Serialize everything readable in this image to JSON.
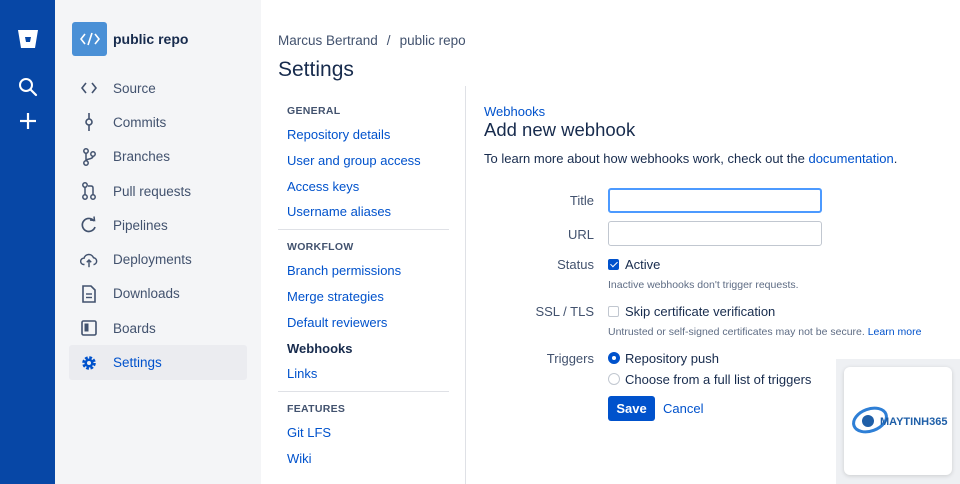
{
  "repo": {
    "name": "public repo"
  },
  "project_nav": [
    {
      "label": "Source",
      "icon": "code-icon"
    },
    {
      "label": "Commits",
      "icon": "commit-icon"
    },
    {
      "label": "Branches",
      "icon": "branch-icon"
    },
    {
      "label": "Pull requests",
      "icon": "pull-request-icon"
    },
    {
      "label": "Pipelines",
      "icon": "pipelines-icon"
    },
    {
      "label": "Deployments",
      "icon": "cloud-upload-icon"
    },
    {
      "label": "Downloads",
      "icon": "document-icon"
    },
    {
      "label": "Boards",
      "icon": "board-icon"
    },
    {
      "label": "Settings",
      "icon": "gear-icon",
      "active": true
    }
  ],
  "breadcrumb": {
    "owner": "Marcus Bertrand",
    "separator": "/",
    "repo": "public repo"
  },
  "page_title": "Settings",
  "settings_nav": {
    "general": {
      "heading": "GENERAL",
      "links": [
        "Repository details",
        "User and group access",
        "Access keys",
        "Username aliases"
      ]
    },
    "workflow": {
      "heading": "WORKFLOW",
      "links": [
        "Branch permissions",
        "Merge strategies",
        "Default reviewers",
        "Webhooks",
        "Links"
      ]
    },
    "features": {
      "heading": "FEATURES",
      "links": [
        "Git LFS",
        "Wiki"
      ]
    }
  },
  "webhook": {
    "breadcrumb": "Webhooks",
    "title": "Add new webhook",
    "intro": "To learn more about how webhooks work, check out the ",
    "intro_link": "documentation",
    "intro_end": ".",
    "title_label": "Title",
    "title_value": "",
    "url_label": "URL",
    "url_value": "",
    "status_label": "Status",
    "status_option": "Active",
    "status_checked": true,
    "status_hint": "Inactive webhooks don't trigger requests.",
    "ssl_label": "SSL / TLS",
    "ssl_option": "Skip certificate verification",
    "ssl_checked": false,
    "ssl_hint": "Untrusted or self-signed certificates may not be secure.",
    "ssl_hint_link": "Learn more",
    "triggers_label": "Triggers",
    "trigger_options": [
      "Repository push",
      "Choose from a full list of triggers"
    ],
    "selected_trigger": "Repository push",
    "save_label": "Save",
    "cancel_label": "Cancel"
  },
  "watermark": {
    "brand": "MAYTINH365"
  },
  "colors": {
    "global_nav": "#0747a6",
    "link": "#0052cc",
    "primary_button": "#0052cc",
    "focus_ring": "#4c9aff"
  }
}
